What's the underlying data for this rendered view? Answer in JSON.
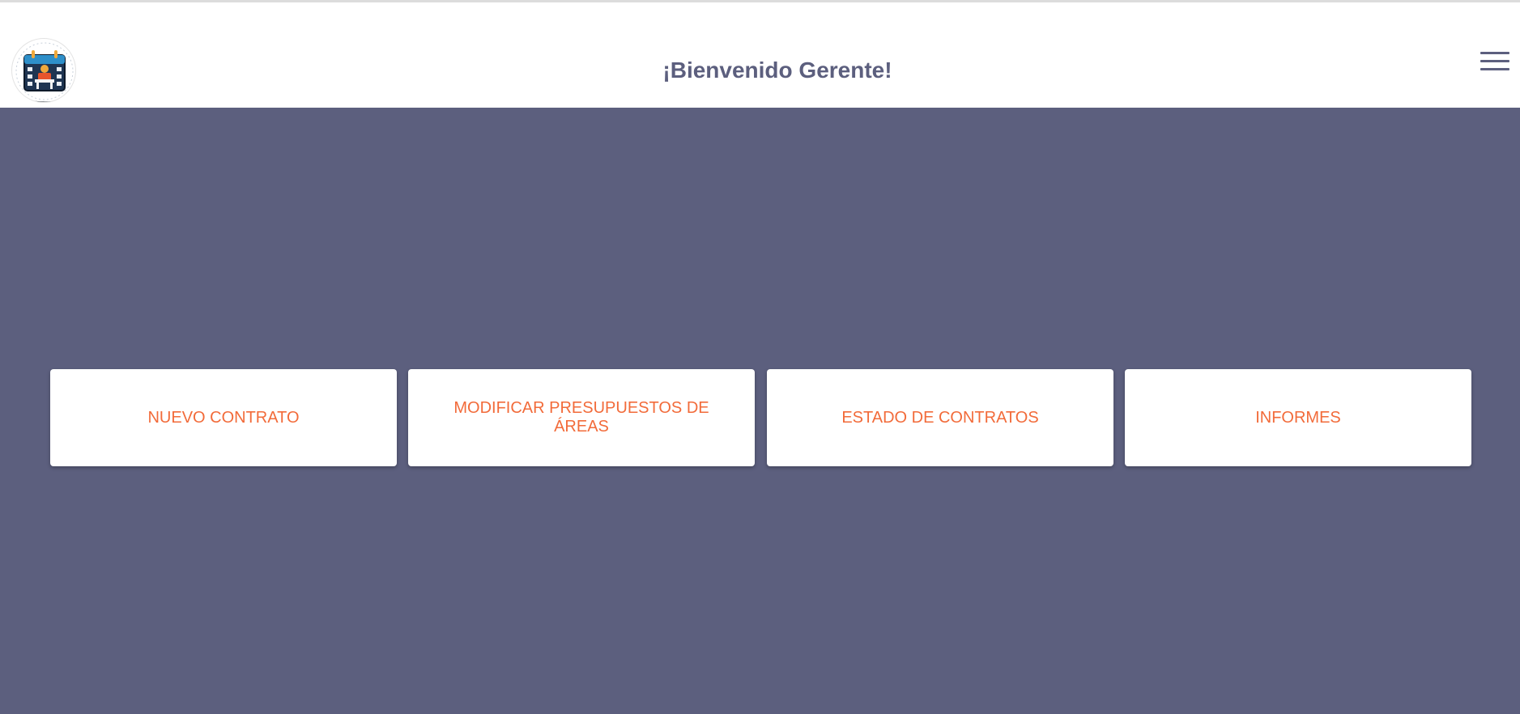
{
  "header": {
    "logo_icon": "contract-calendar-logo-icon",
    "title": "¡Bienvenido Gerente!",
    "menu_icon": "hamburger-menu-icon"
  },
  "colors": {
    "header_background": "#ffffff",
    "page_background": "#5c5f7e",
    "title_text": "#5c5f7e",
    "card_background": "#ffffff",
    "card_text": "#f26b3a"
  },
  "cards": [
    {
      "label": "NUEVO CONTRATO"
    },
    {
      "label": "MODIFICAR PRESUPUESTOS DE ÁREAS"
    },
    {
      "label": "ESTADO DE CONTRATOS"
    },
    {
      "label": "INFORMES"
    }
  ]
}
